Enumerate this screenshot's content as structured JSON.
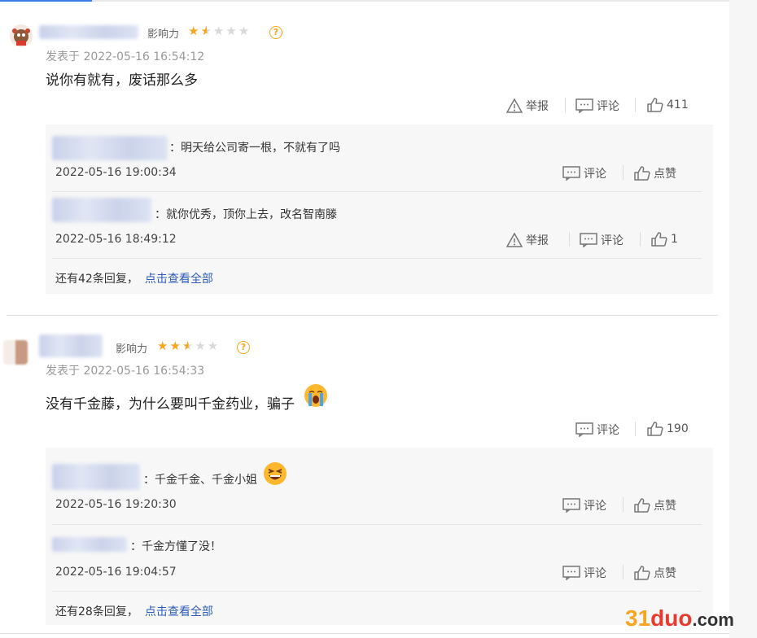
{
  "comments": [
    {
      "influence_label": "影响力",
      "stars_on": 1.5,
      "time": "发表于 2022-05-16 16:54:12",
      "text": "说你有就有，废话那么多",
      "report": "举报",
      "comment": "评论",
      "likes": "411",
      "replies": [
        {
          "text": "：明天给公司寄一根，不就有了吗",
          "time": "2022-05-16 19:00:34",
          "comment": "评论",
          "like": "点赞"
        },
        {
          "text": "：就你优秀，顶你上去，改名智南滕",
          "time": "2022-05-16 18:49:12",
          "report": "举报",
          "comment": "评论",
          "like": "1"
        }
      ],
      "more_text": "还有42条回复，",
      "more_link": "点击查看全部"
    },
    {
      "influence_label": "影响力",
      "stars_on": 2.5,
      "time": "发表于 2022-05-16 16:54:33",
      "text": "没有千金藤，为什么要叫千金药业，骗子",
      "comment": "评论",
      "likes": "190",
      "replies": [
        {
          "text": "：千金千金、千金小姐",
          "time": "2022-05-16 19:20:30",
          "comment": "评论",
          "like": "点赞"
        },
        {
          "text": "：千金方懂了没！",
          "time": "2022-05-16 19:04:57",
          "comment": "评论",
          "like": "点赞"
        }
      ],
      "more_text": "还有28条回复，",
      "more_link": "点击查看全部"
    }
  ],
  "watermark": {
    "num": "31",
    "rest": "duo",
    "suffix": ".com"
  },
  "colors": {
    "star": "#f4a51c",
    "link": "#2e5cb8",
    "reply_bg": "#f7f7f7",
    "watermark_orange": "#f5a623",
    "watermark_red": "#e63b2e"
  },
  "icons": {
    "report": "warning-triangle-icon",
    "comment": "comment-bubble-icon",
    "like": "thumbs-up-icon",
    "help": "question-circle-icon"
  }
}
